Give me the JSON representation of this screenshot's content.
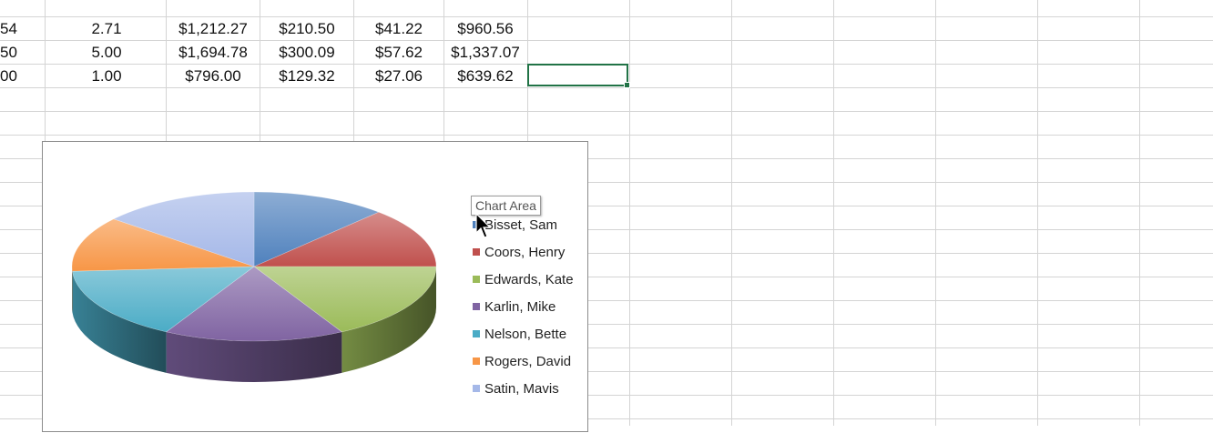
{
  "spreadsheet": {
    "rows": [
      [
        "54",
        "2.71",
        "$1,212.27",
        "$210.50",
        "$41.22",
        "$960.56"
      ],
      [
        "50",
        "5.00",
        "$1,694.78",
        "$300.09",
        "$57.62",
        "$1,337.07"
      ],
      [
        "00",
        "1.00",
        "$796.00",
        "$129.32",
        "$27.06",
        "$639.62"
      ]
    ]
  },
  "chart": {
    "tooltip": "Chart Area"
  },
  "chart_data": {
    "type": "pie",
    "title": "",
    "categories": [
      "Bisset, Sam",
      "Coors, Henry",
      "Edwards, Kate",
      "Karlin, Mike",
      "Nelson, Bette",
      "Rogers, David",
      "Satin, Mavis"
    ],
    "values": [
      12,
      13,
      17,
      16,
      16,
      12,
      14
    ],
    "colors": [
      "#4f81bd",
      "#c0504d",
      "#9bbb59",
      "#8064a2",
      "#4bacc6",
      "#f79646",
      "#a5b8e8"
    ],
    "legend": "right",
    "style": "3d"
  }
}
